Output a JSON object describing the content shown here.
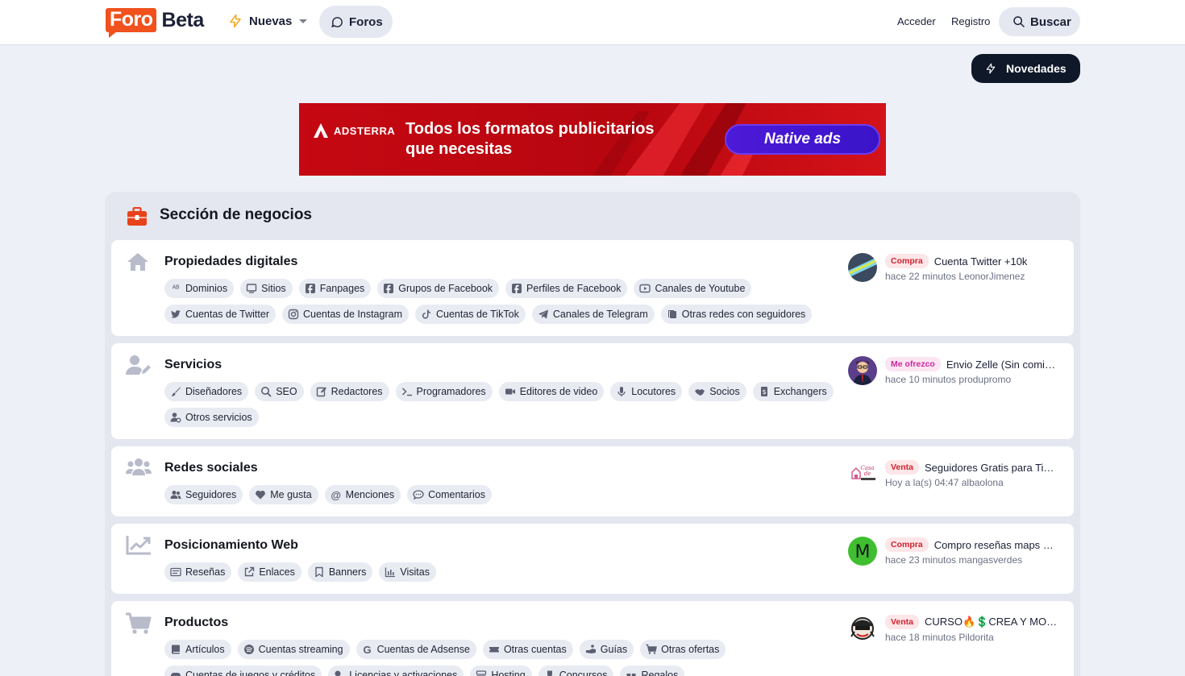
{
  "header": {
    "logo_foro": "Foro",
    "logo_beta": "Beta",
    "nav_nuevas": "Nuevas",
    "nav_foros": "Foros",
    "acceder": "Acceder",
    "registro": "Registro",
    "buscar": "Buscar"
  },
  "novedades": "Novedades",
  "banner": {
    "brand": "ADSTERRA",
    "text": "Todos los formatos publicitarios que necesitas",
    "button": "Native ads"
  },
  "section": {
    "title": "Sección de negocios"
  },
  "colors": {
    "brand": "#f0511d",
    "dark": "#0f1828",
    "banner": "#c50812",
    "banner_button": "#4d1ad8"
  },
  "categories": [
    {
      "title": "Propiedades digitales",
      "icon": "home-icon",
      "chips": [
        {
          "label": "Dominios",
          "icon": "ab-icon"
        },
        {
          "label": "Sitios",
          "icon": "monitor-icon"
        },
        {
          "label": "Fanpages",
          "icon": "facebook-icon"
        },
        {
          "label": "Grupos de Facebook",
          "icon": "facebook-icon"
        },
        {
          "label": "Perfiles de Facebook",
          "icon": "facebook-icon"
        },
        {
          "label": "Canales de Youtube",
          "icon": "youtube-icon"
        },
        {
          "label": "Cuentas de Twitter",
          "icon": "twitter-icon"
        },
        {
          "label": "Cuentas de Instagram",
          "icon": "instagram-icon"
        },
        {
          "label": "Cuentas de TikTok",
          "icon": "tiktok-icon"
        },
        {
          "label": "Canales de Telegram",
          "icon": "telegram-icon"
        },
        {
          "label": "Otras redes con seguidores",
          "icon": "pages-icon"
        }
      ],
      "latest": {
        "tag": "Compra",
        "title": "Cuenta Twitter +10k",
        "time": "hace 22 minutos",
        "user": "LeonorJimenez"
      }
    },
    {
      "title": "Servicios",
      "icon": "user-pen-icon",
      "chips": [
        {
          "label": "Diseñadores",
          "icon": "brush-icon"
        },
        {
          "label": "SEO",
          "icon": "search-icon"
        },
        {
          "label": "Redactores",
          "icon": "edit-icon"
        },
        {
          "label": "Programadores",
          "icon": "terminal-icon"
        },
        {
          "label": "Editores de video",
          "icon": "video-icon"
        },
        {
          "label": "Locutores",
          "icon": "mic-icon"
        },
        {
          "label": "Socios",
          "icon": "handshake-icon"
        },
        {
          "label": "Exchangers",
          "icon": "exchange-icon"
        },
        {
          "label": "Otros servicios",
          "icon": "user-gear-icon"
        }
      ],
      "latest": {
        "tag": "Me ofrezco",
        "title": "Envio Zelle (Sin comi…",
        "time": "hace 10 minutos",
        "user": "produpromo"
      }
    },
    {
      "title": "Redes sociales",
      "icon": "users-icon",
      "chips": [
        {
          "label": "Seguidores",
          "icon": "users-icon"
        },
        {
          "label": "Me gusta",
          "icon": "heart-icon"
        },
        {
          "label": "Menciones",
          "icon": "at-icon"
        },
        {
          "label": "Comentarios",
          "icon": "comment-icon"
        }
      ],
      "latest": {
        "tag": "Venta",
        "title": "Seguidores Gratis para Ti…",
        "time": "Hoy a la(s) 04:47",
        "user": "albaolona"
      }
    },
    {
      "title": "Posicionamiento Web",
      "icon": "chart-line-icon",
      "chips": [
        {
          "label": "Reseñas",
          "icon": "review-icon"
        },
        {
          "label": "Enlaces",
          "icon": "external-link-icon"
        },
        {
          "label": "Banners",
          "icon": "bookmark-icon"
        },
        {
          "label": "Visitas",
          "icon": "bars-icon"
        }
      ],
      "latest": {
        "tag": "Compra",
        "title": "Compro reseñas maps …",
        "time": "hace 23 minutos",
        "user": "mangasverdes"
      }
    },
    {
      "title": "Productos",
      "icon": "cart-icon",
      "chips": [
        {
          "label": "Artículos",
          "icon": "book-icon"
        },
        {
          "label": "Cuentas streaming",
          "icon": "spotify-icon"
        },
        {
          "label": "Cuentas de Adsense",
          "icon": "google-icon"
        },
        {
          "label": "Otras cuentas",
          "icon": "ticket-icon"
        },
        {
          "label": "Guías",
          "icon": "hand-icon"
        },
        {
          "label": "Otras ofertas",
          "icon": "cart-icon"
        },
        {
          "label": "Cuentas de juegos y créditos",
          "icon": "gamepad-icon"
        },
        {
          "label": "Licencias y activaciones",
          "icon": "key-icon"
        },
        {
          "label": "Hosting",
          "icon": "server-icon"
        },
        {
          "label": "Concursos",
          "icon": "trophy-icon"
        },
        {
          "label": "Regalos",
          "icon": "gift-icon"
        }
      ],
      "latest": {
        "tag": "Venta",
        "title": "CURSO🔥💲CREA Y MO…",
        "time": "hace 18 minutos",
        "user": "Pildorita"
      }
    }
  ]
}
